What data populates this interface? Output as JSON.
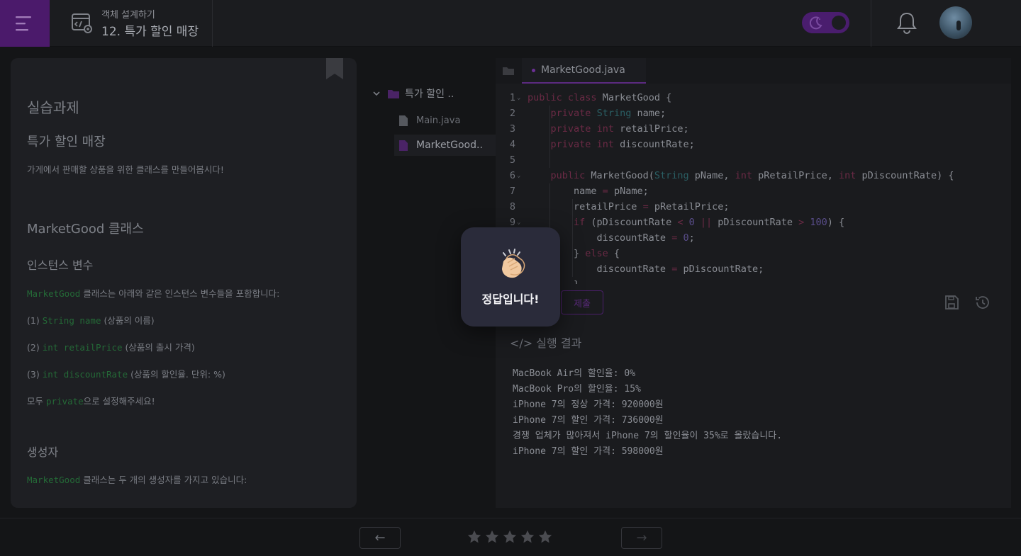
{
  "header": {
    "course_subtitle": "객체 설계하기",
    "course_title": "12. 특가 할인 매장",
    "accent_color": "#4b1a6b"
  },
  "lesson": {
    "section_label": "실습과제",
    "title": "특가 할인 매장",
    "intro": "가게에서 판매할 상품을 위한 클래스를 만들어봅시다!",
    "class_heading": "MarketGood 클래스",
    "instance_heading": "인스턴스 변수",
    "instance_desc_code": "MarketGood",
    "instance_desc_text": " 클래스는 아래와 같은 인스턴스 변수들을 포함합니다:",
    "items": [
      {
        "prefix": "(1) ",
        "code": "String name",
        "desc": " (상품의 이름)"
      },
      {
        "prefix": "(2) ",
        "code": "int retailPrice",
        "desc": " (상품의 출시 가격)"
      },
      {
        "prefix": "(3) ",
        "code": "int discountRate",
        "desc": " (상품의 할인율. 단위: %)"
      }
    ],
    "private_pre": "모두 ",
    "private_code": "private",
    "private_post": "으로 설정해주세요!",
    "ctor_heading": "생성자",
    "ctor_desc_code": "MarketGood",
    "ctor_desc_text": " 클래스는 두 개의 생성자를 가지고 있습니다:"
  },
  "tree": {
    "folder": "특가 할인 ..",
    "files": [
      "Main.java",
      "MarketGood.."
    ]
  },
  "editor": {
    "active_tab": "MarketGood.java",
    "line_numbers": [
      "1",
      "2",
      "3",
      "4",
      "5",
      "6",
      "7",
      "8",
      "9"
    ],
    "submit_label": "제출"
  },
  "result": {
    "title": "</> 실행 결과",
    "lines": [
      "MacBook Air의 할인율: 0%",
      "MacBook Pro의 할인율: 15%",
      "iPhone 7의 정상 가격: 920000원",
      "iPhone 7의 할인 가격: 736000원",
      "경쟁 업체가 많아져서 iPhone 7의 할인율이 35%로 올랐습니다.",
      "iPhone 7의 할인 가격: 598000원"
    ]
  },
  "footer": {
    "prev_label": "←",
    "next_label": "→",
    "rating": 0,
    "rating_max": 5
  },
  "toast": {
    "emoji_icon": "clapping-hands-icon",
    "message": "정답입니다!"
  }
}
